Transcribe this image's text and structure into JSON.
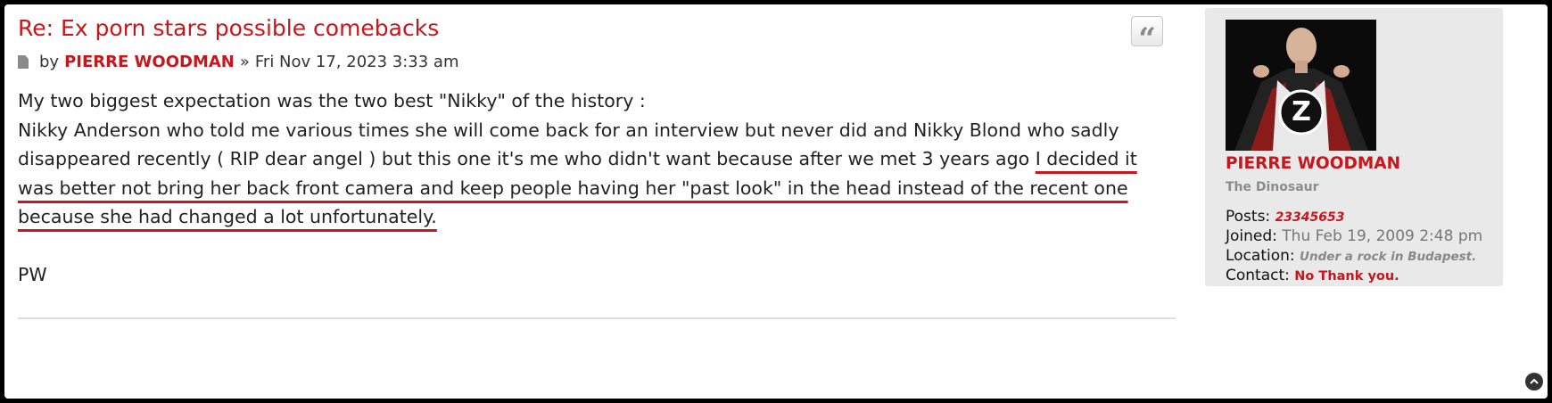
{
  "post": {
    "title": "Re: Ex porn stars possible comebacks",
    "meta_by": "by",
    "author": "PIERRE WOODMAN",
    "meta_sep": "»",
    "date": "Fri Nov 17, 2023 3:33 am",
    "quote_icon": "quote-icon",
    "body": {
      "line1": "My two biggest expectation was the two best \"Nikky\" of the history :",
      "para2_plain": "Nikky Anderson who told me various times she will come back for an interview but never did and Nikky Blond who sadly disappeared recently ( RIP dear angel ) but this one it's me who didn't want because after we met 3 years ago ",
      "para2_underlined": "I decided it was better not bring her back front camera and keep people having her \"past look\" in the head instead of the recent one because she had changed a lot unfortunately.",
      "signature": "PW"
    },
    "underline_color": "#c8161d"
  },
  "profile": {
    "name": "PIERRE WOODMAN",
    "rank": "The Dinosaur",
    "posts_label": "Posts:",
    "posts_value": "23345653",
    "joined_label": "Joined:",
    "joined_value": "Thu Feb 19, 2009 2:48 pm",
    "location_label": "Location:",
    "location_value": "Under a rock in Budapest.",
    "contact_label": "Contact:",
    "contact_value": "No Thank you.",
    "avatar_icon": "avatar-superhero-z",
    "avatar_letter": "Z"
  },
  "colors": {
    "accent": "#c8161d",
    "profile_bg": "#e9e9e9",
    "text": "#222222"
  },
  "back_to_top_icon": "chevron-up-circle-icon"
}
